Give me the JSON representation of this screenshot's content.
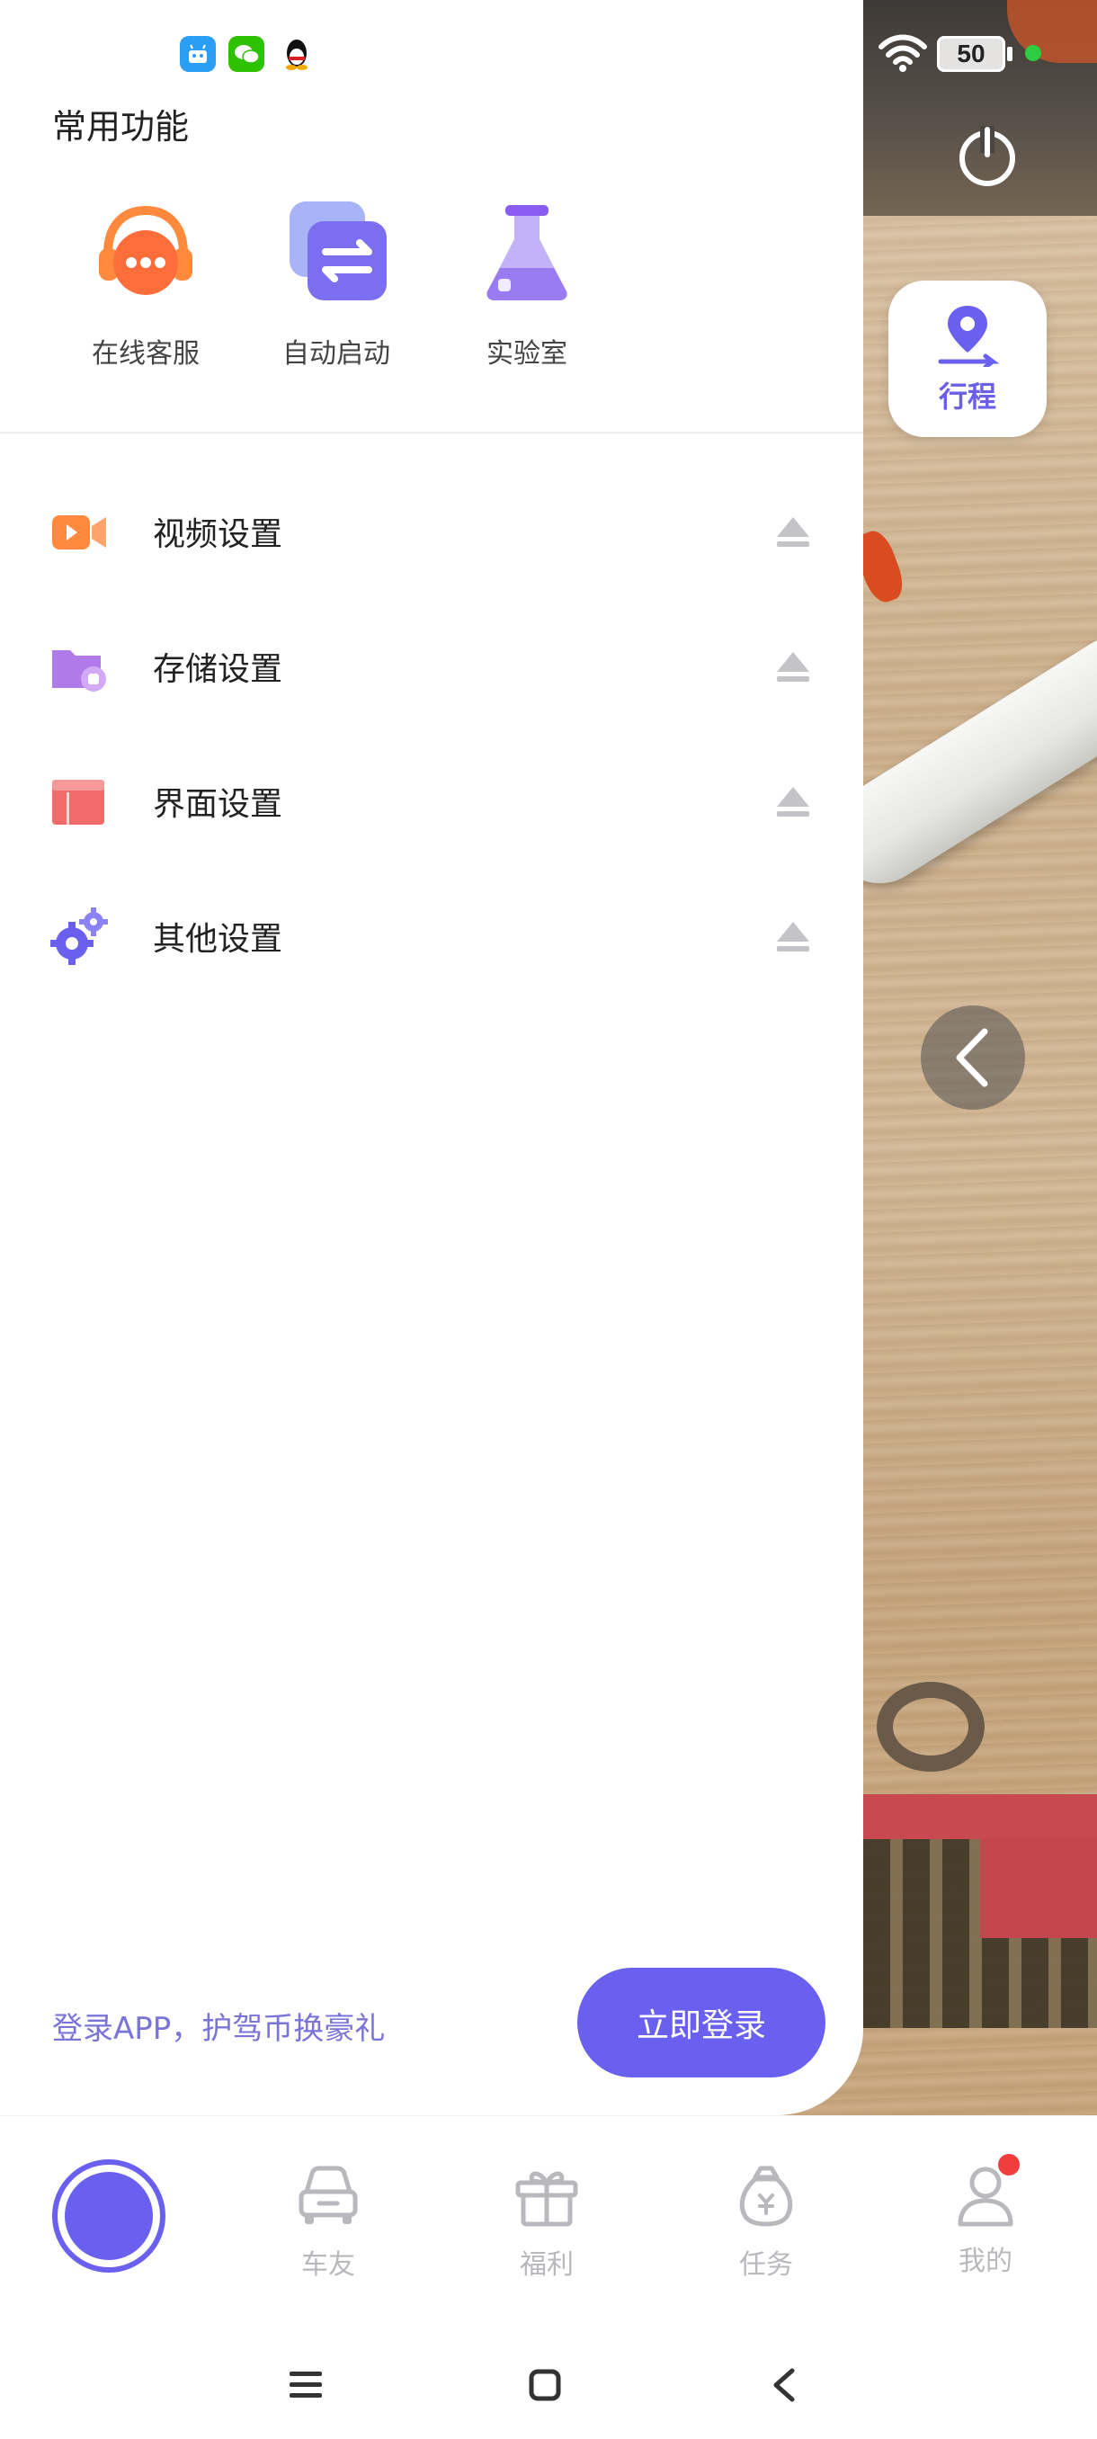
{
  "status_bar": {
    "battery_level": "50",
    "notification_apps": [
      "android-app-icon",
      "wechat-icon",
      "qq-icon"
    ]
  },
  "drawer": {
    "section_title": "常用功能",
    "quick_actions": [
      {
        "label": "在线客服",
        "icon": "headset-chat-icon"
      },
      {
        "label": "自动启动",
        "icon": "swap-arrows-icon"
      },
      {
        "label": "实验室",
        "icon": "flask-icon"
      }
    ],
    "settings": [
      {
        "label": "视频设置",
        "icon": "video-camera-icon"
      },
      {
        "label": "存储设置",
        "icon": "storage-folder-icon"
      },
      {
        "label": "界面设置",
        "icon": "layout-icon"
      },
      {
        "label": "其他设置",
        "icon": "gears-icon"
      }
    ],
    "login_promo": "登录APP，护驾币换豪礼",
    "login_button": "立即登录"
  },
  "overlay": {
    "trip_label": "行程"
  },
  "bottom_nav": {
    "items": [
      {
        "label": "车友",
        "icon": "car-icon"
      },
      {
        "label": "福利",
        "icon": "gift-icon"
      },
      {
        "label": "任务",
        "icon": "money-bag-icon"
      },
      {
        "label": "我的",
        "icon": "user-icon",
        "has_badge": true
      }
    ]
  },
  "colors": {
    "accent": "#6a60f0",
    "promo_text": "#7b74d8",
    "inactive_nav": "#b8b8bd",
    "badge": "#f23d3d"
  }
}
